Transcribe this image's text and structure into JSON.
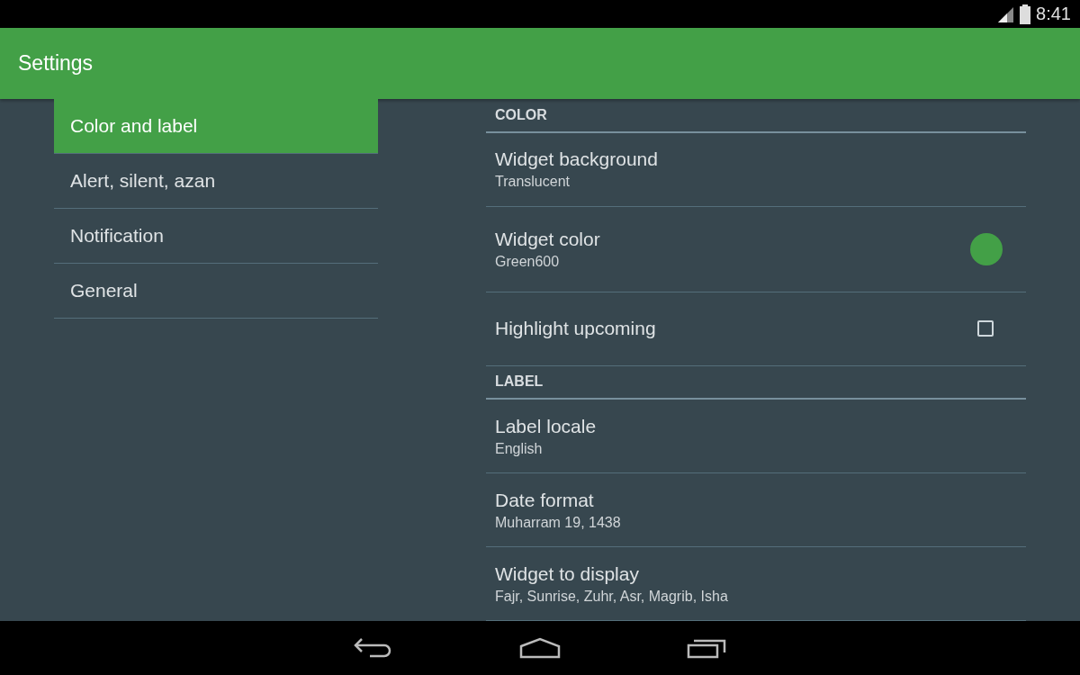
{
  "status_bar": {
    "time": "8:41"
  },
  "app_bar": {
    "title": "Settings"
  },
  "sidebar": {
    "items": [
      {
        "label": "Color and label",
        "selected": true
      },
      {
        "label": "Alert, silent, azan",
        "selected": false
      },
      {
        "label": "Notification",
        "selected": false
      },
      {
        "label": "General",
        "selected": false
      }
    ]
  },
  "preferences": [
    {
      "kind": "header",
      "title": "COLOR"
    },
    {
      "kind": "item",
      "title": "Widget background",
      "summary": "Translucent"
    },
    {
      "kind": "color",
      "title": "Widget color",
      "summary": "Green600",
      "color": "#43a047"
    },
    {
      "kind": "checkbox",
      "title": "Highlight upcoming",
      "checked": false
    },
    {
      "kind": "header",
      "title": "LABEL"
    },
    {
      "kind": "item",
      "title": "Label locale",
      "summary": "English"
    },
    {
      "kind": "item",
      "title": "Date format",
      "summary": "Muharram 19, 1438"
    },
    {
      "kind": "item",
      "title": "Widget to display",
      "summary": "Fajr, Sunrise, Zuhr, Asr, Magrib, Isha"
    }
  ]
}
